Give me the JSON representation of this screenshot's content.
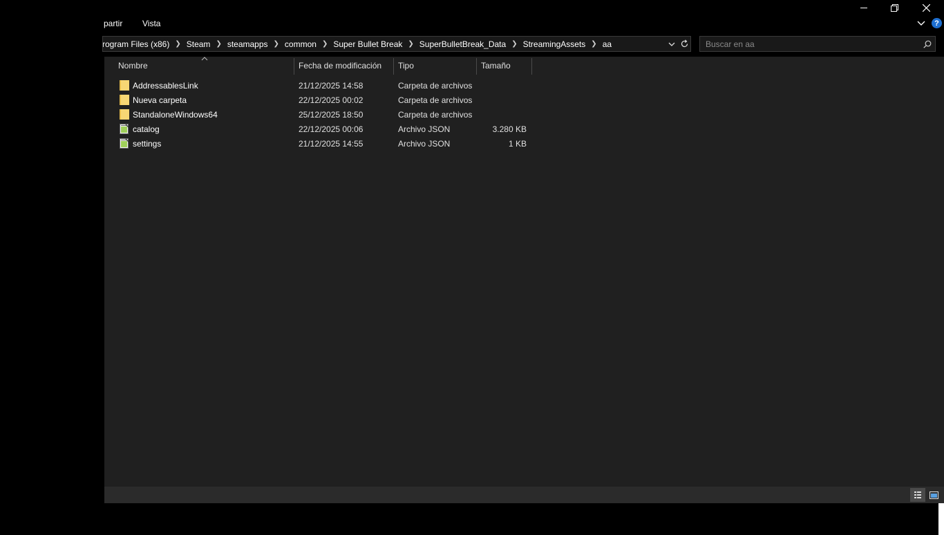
{
  "ribbon": {
    "tab_share": "partir",
    "tab_view": "Vista"
  },
  "address": {
    "crumbs": [
      "rogram Files (x86)",
      "Steam",
      "steamapps",
      "common",
      "Super Bullet Break",
      "SuperBulletBreak_Data",
      "StreamingAssets",
      "aa"
    ]
  },
  "search": {
    "placeholder": "Buscar en aa",
    "value": ""
  },
  "columns": {
    "name": "Nombre",
    "date": "Fecha de modificación",
    "type": "Tipo",
    "size": "Tamaño"
  },
  "files": [
    {
      "name": "AddressablesLink",
      "date": "21/12/2025 14:58",
      "type": "Carpeta de archivos",
      "size": "",
      "icon": "folder-icon"
    },
    {
      "name": "Nueva carpeta",
      "date": "22/12/2025 00:02",
      "type": "Carpeta de archivos",
      "size": "",
      "icon": "folder-icon"
    },
    {
      "name": "StandaloneWindows64",
      "date": "25/12/2025 18:50",
      "type": "Carpeta de archivos",
      "size": "",
      "icon": "folder-icon"
    },
    {
      "name": "catalog",
      "date": "22/12/2025 00:06",
      "type": "Archivo JSON",
      "size": "3.280 KB",
      "icon": "json-file-icon"
    },
    {
      "name": "settings",
      "date": "21/12/2025 14:55",
      "type": "Archivo JSON",
      "size": "1 KB",
      "icon": "json-file-icon"
    }
  ],
  "colors": {
    "background": "#202020",
    "folder": "#f7d774",
    "help": "#1e6fd0"
  }
}
